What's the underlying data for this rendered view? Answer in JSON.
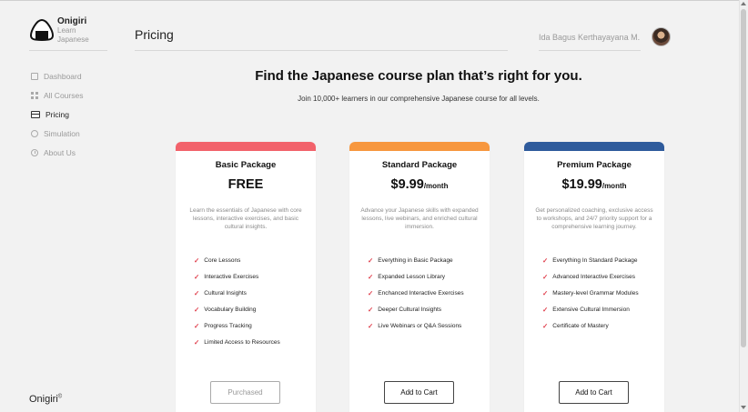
{
  "brand": {
    "name": "Onigiri",
    "sub1": "Learn",
    "sub2": "Japanese",
    "footer": "Onigiri",
    "footer_mark": "©"
  },
  "nav": [
    {
      "label": "Dashboard",
      "icon": "dashboard-icon",
      "active": false
    },
    {
      "label": "All Courses",
      "icon": "grid-icon",
      "active": false
    },
    {
      "label": "Pricing",
      "icon": "card-icon",
      "active": true
    },
    {
      "label": "Simulation",
      "icon": "circle-icon",
      "active": false
    },
    {
      "label": "About Us",
      "icon": "info-icon",
      "active": false
    }
  ],
  "header": {
    "title": "Pricing",
    "user_name": "Ida Bagus Kerthayayana M."
  },
  "hero": {
    "title": "Find the Japanese course plan that’s right for you.",
    "subtitle": "Join 10,000+ learners in our comprehensive Japanese course for all levels."
  },
  "plans": [
    {
      "name": "Basic Package",
      "price": "FREE",
      "period": "",
      "accent": "#f2626b",
      "description": "Learn the essentials of Japanese with core lessons, interactive exercises, and basic cultural insights.",
      "features": [
        "Core Lessons",
        "Interactive Exercises",
        "Cultural Insights",
        "Vocabulary Building",
        "Progress Tracking",
        "Limited Access to Resources"
      ],
      "button": "Purchased",
      "button_disabled": true
    },
    {
      "name": "Standard Package",
      "price": "$9.99",
      "period": "/month",
      "accent": "#f7973e",
      "description": "Advance your Japanese skills with expanded lessons, live webinars, and enriched cultural immersion.",
      "features": [
        "Everything in Basic Package",
        "Expanded Lesson Library",
        "Enchanced Interactive Exercises",
        "Deeper Cultural Insights",
        "Live Webinars or Q&A Sessions"
      ],
      "button": "Add to Cart",
      "button_disabled": false
    },
    {
      "name": "Premium Package",
      "price": "$19.99",
      "period": "/month",
      "accent": "#2f5b9c",
      "description": "Get personalized coaching, exclusive access to workshops, and 24/7 priority support for a comprehensive learning journey.",
      "features": [
        "Everything In Standard Package",
        "Advanced Interactive Exercises",
        "Mastery-level Grammar Modules",
        "Extensive Cultural Immersion",
        "Certificate of Mastery"
      ],
      "button": "Add to Cart",
      "button_disabled": false
    }
  ],
  "check_glyph": "✓"
}
